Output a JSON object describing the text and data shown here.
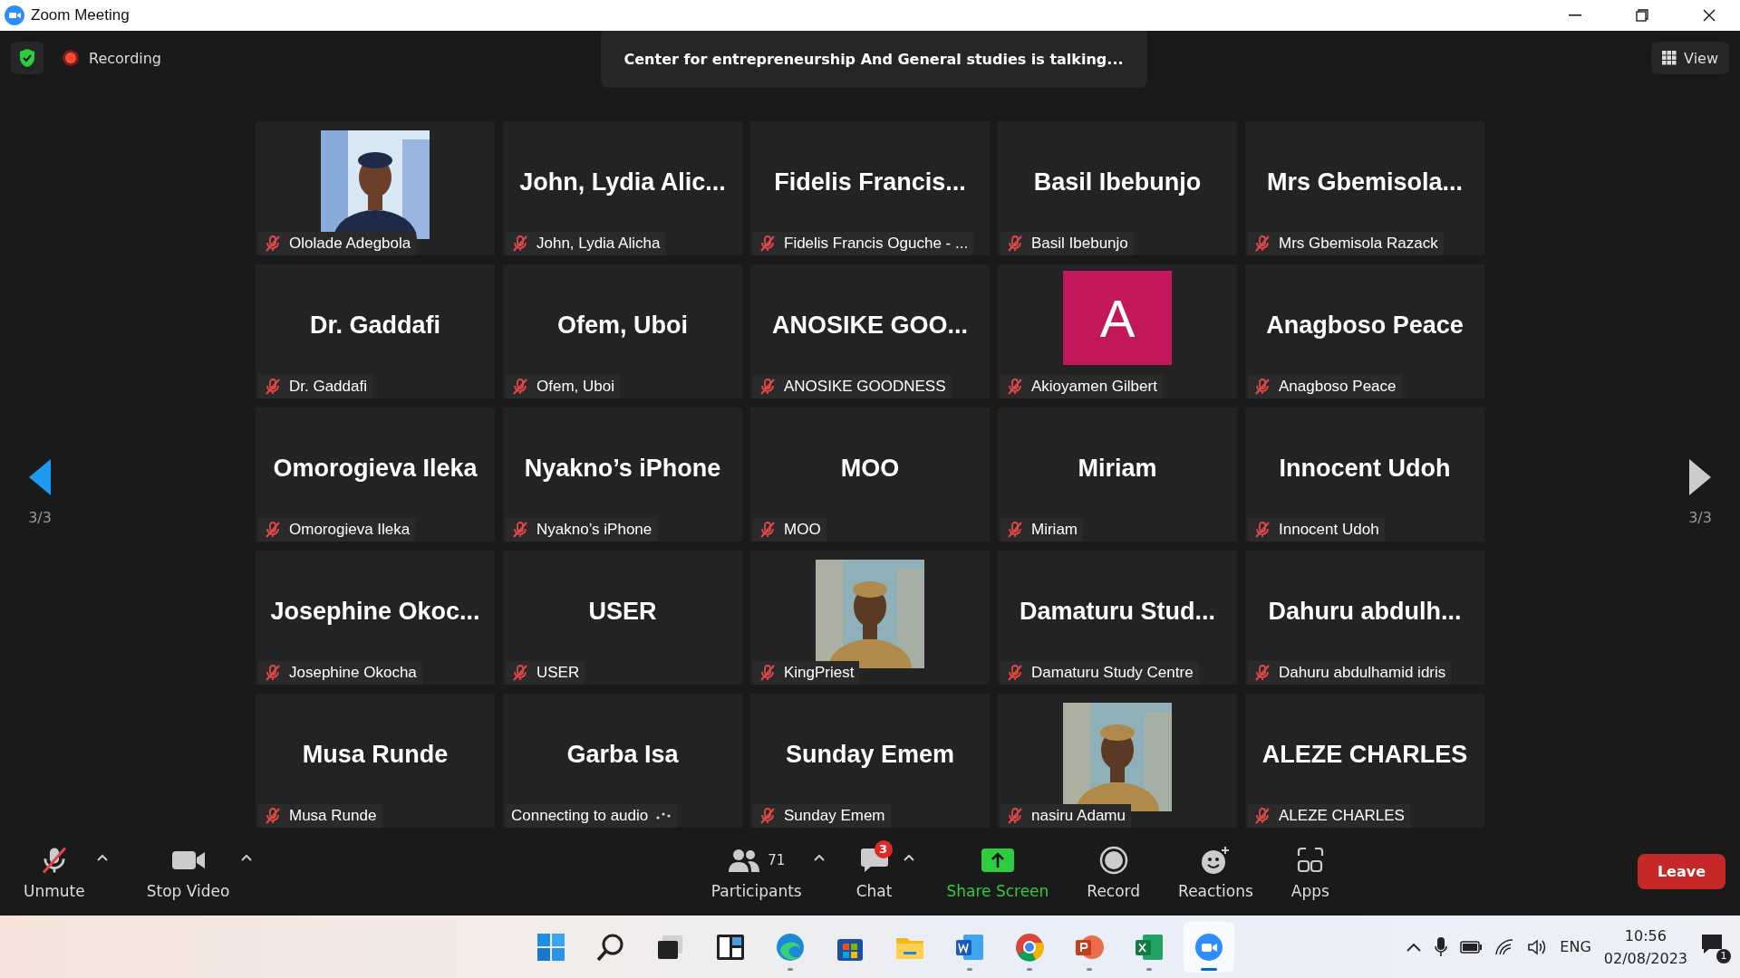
{
  "window": {
    "title": "Zoom Meeting"
  },
  "top_bar": {
    "recording": "Recording",
    "speaker_banner": "Center for entrepreneurship And General studies is talking...",
    "view_button": "View"
  },
  "pager": {
    "left": "3/3",
    "right": "3/3"
  },
  "tiles": [
    {
      "caption": "Ololade Adegbola",
      "mic_muted": true,
      "connecting": false
    },
    {
      "kind": "name",
      "title": "John, Lydia Alic...",
      "caption": "John, Lydia Alicha",
      "mic_muted": true,
      "connecting": false
    },
    {
      "kind": "name",
      "title": "Fidelis Francis...",
      "caption": "Fidelis Francis Oguche - ...",
      "mic_muted": true,
      "connecting": false
    },
    {
      "kind": "name",
      "title": "Basil Ibebunjo",
      "caption": "Basil Ibebunjo",
      "mic_muted": true,
      "connecting": false
    },
    {
      "kind": "name",
      "title": "Mrs Gbemisola...",
      "caption": "Mrs Gbemisola Razack",
      "mic_muted": true,
      "connecting": false
    },
    {
      "kind": "name",
      "title": "Dr. Gaddafi",
      "caption": "Dr. Gaddafi",
      "mic_muted": true,
      "connecting": false
    },
    {
      "kind": "name",
      "title": "Ofem, Uboi",
      "caption": "Ofem, Uboi",
      "mic_muted": true,
      "connecting": false
    },
    {
      "kind": "name",
      "title": "ANOSIKE GOO...",
      "caption": "ANOSIKE GOODNESS",
      "mic_muted": true,
      "connecting": false
    },
    {
      "kind": "avatar",
      "title": "A",
      "color": "#c2185b",
      "caption": "Akioyamen Gilbert",
      "mic_muted": true,
      "connecting": false
    },
    {
      "kind": "name",
      "title": "Anagboso Peace",
      "caption": "Anagboso Peace",
      "mic_muted": true,
      "connecting": false
    },
    {
      "kind": "name",
      "title": "Omorogieva Ileka",
      "caption": "Omorogieva Ileka",
      "mic_muted": true,
      "connecting": false
    },
    {
      "kind": "name",
      "title": "Nyakno’s iPhone",
      "caption": "Nyakno’s iPhone",
      "mic_muted": true,
      "connecting": false
    },
    {
      "kind": "name",
      "title": "MOO",
      "caption": "MOO",
      "mic_muted": true,
      "connecting": false
    },
    {
      "kind": "name",
      "title": "Miriam",
      "caption": "Miriam",
      "mic_muted": true,
      "connecting": false
    },
    {
      "kind": "name",
      "title": "Innocent Udoh",
      "caption": "Innocent Udoh",
      "mic_muted": true,
      "connecting": false
    },
    {
      "kind": "name",
      "title": "Josephine Okoc...",
      "caption": "Josephine Okocha",
      "mic_muted": true,
      "connecting": false
    },
    {
      "kind": "name",
      "title": "USER",
      "caption": "USER",
      "mic_muted": true,
      "connecting": false
    },
    {
      "caption": "KingPriest",
      "mic_muted": true,
      "connecting": false
    },
    {
      "kind": "name",
      "title": "Damaturu Stud...",
      "caption": "Damaturu Study Centre",
      "mic_muted": true,
      "connecting": false
    },
    {
      "kind": "name",
      "title": "Dahuru abdulh...",
      "caption": "Dahuru abdulhamid idris",
      "mic_muted": true,
      "connecting": false
    },
    {
      "kind": "name",
      "title": "Musa Runde",
      "caption": "Musa Runde",
      "mic_muted": true,
      "connecting": false
    },
    {
      "kind": "name",
      "title": "Garba Isa",
      "caption": "Connecting to audio",
      "mic_muted": false,
      "connecting": true
    },
    {
      "kind": "name",
      "title": "Sunday Emem",
      "caption": "Sunday Emem",
      "mic_muted": true,
      "connecting": false
    },
    {
      "caption": "nasiru Adamu",
      "mic_muted": true,
      "connecting": false
    },
    {
      "kind": "name",
      "title": "ALEZE CHARLES",
      "caption": "ALEZE CHARLES",
      "mic_muted": true,
      "connecting": false
    }
  ],
  "toolbar": {
    "left": [
      {
        "kind": "mic",
        "label": "Unmute"
      },
      {
        "kind": "video",
        "label": "Stop Video"
      }
    ],
    "center": [
      {
        "kind": "participants",
        "label": "Participants",
        "count": "71",
        "caret": true
      },
      {
        "kind": "chat",
        "label": "Chat",
        "badge": "3",
        "caret": true
      },
      {
        "kind": "share",
        "label": "Share Screen",
        "caret": false
      },
      {
        "kind": "record",
        "label": "Record",
        "caret": false
      },
      {
        "kind": "reactions",
        "label": "Reactions",
        "caret": false
      },
      {
        "kind": "apps",
        "label": "Apps",
        "caret": false
      }
    ],
    "leave": "Leave"
  },
  "taskbar": {
    "apps": [
      {
        "kind": "start",
        "running": false,
        "active": false
      },
      {
        "kind": "search",
        "running": false,
        "active": false
      },
      {
        "kind": "taskview",
        "running": false,
        "active": false
      },
      {
        "kind": "widgets",
        "running": false,
        "active": false
      },
      {
        "kind": "edge",
        "running": true,
        "active": false
      },
      {
        "kind": "store",
        "running": false,
        "active": false
      },
      {
        "kind": "files",
        "running": false,
        "active": false
      },
      {
        "kind": "word",
        "running": true,
        "active": false
      },
      {
        "kind": "chrome",
        "running": true,
        "active": false
      },
      {
        "kind": "powerpoint",
        "running": true,
        "active": false
      },
      {
        "kind": "excel",
        "running": true,
        "active": false
      },
      {
        "kind": "zoom",
        "running": true,
        "active": true
      }
    ],
    "language": "ENG",
    "time": "10:56",
    "date": "02/08/2023",
    "notifications": "1"
  }
}
